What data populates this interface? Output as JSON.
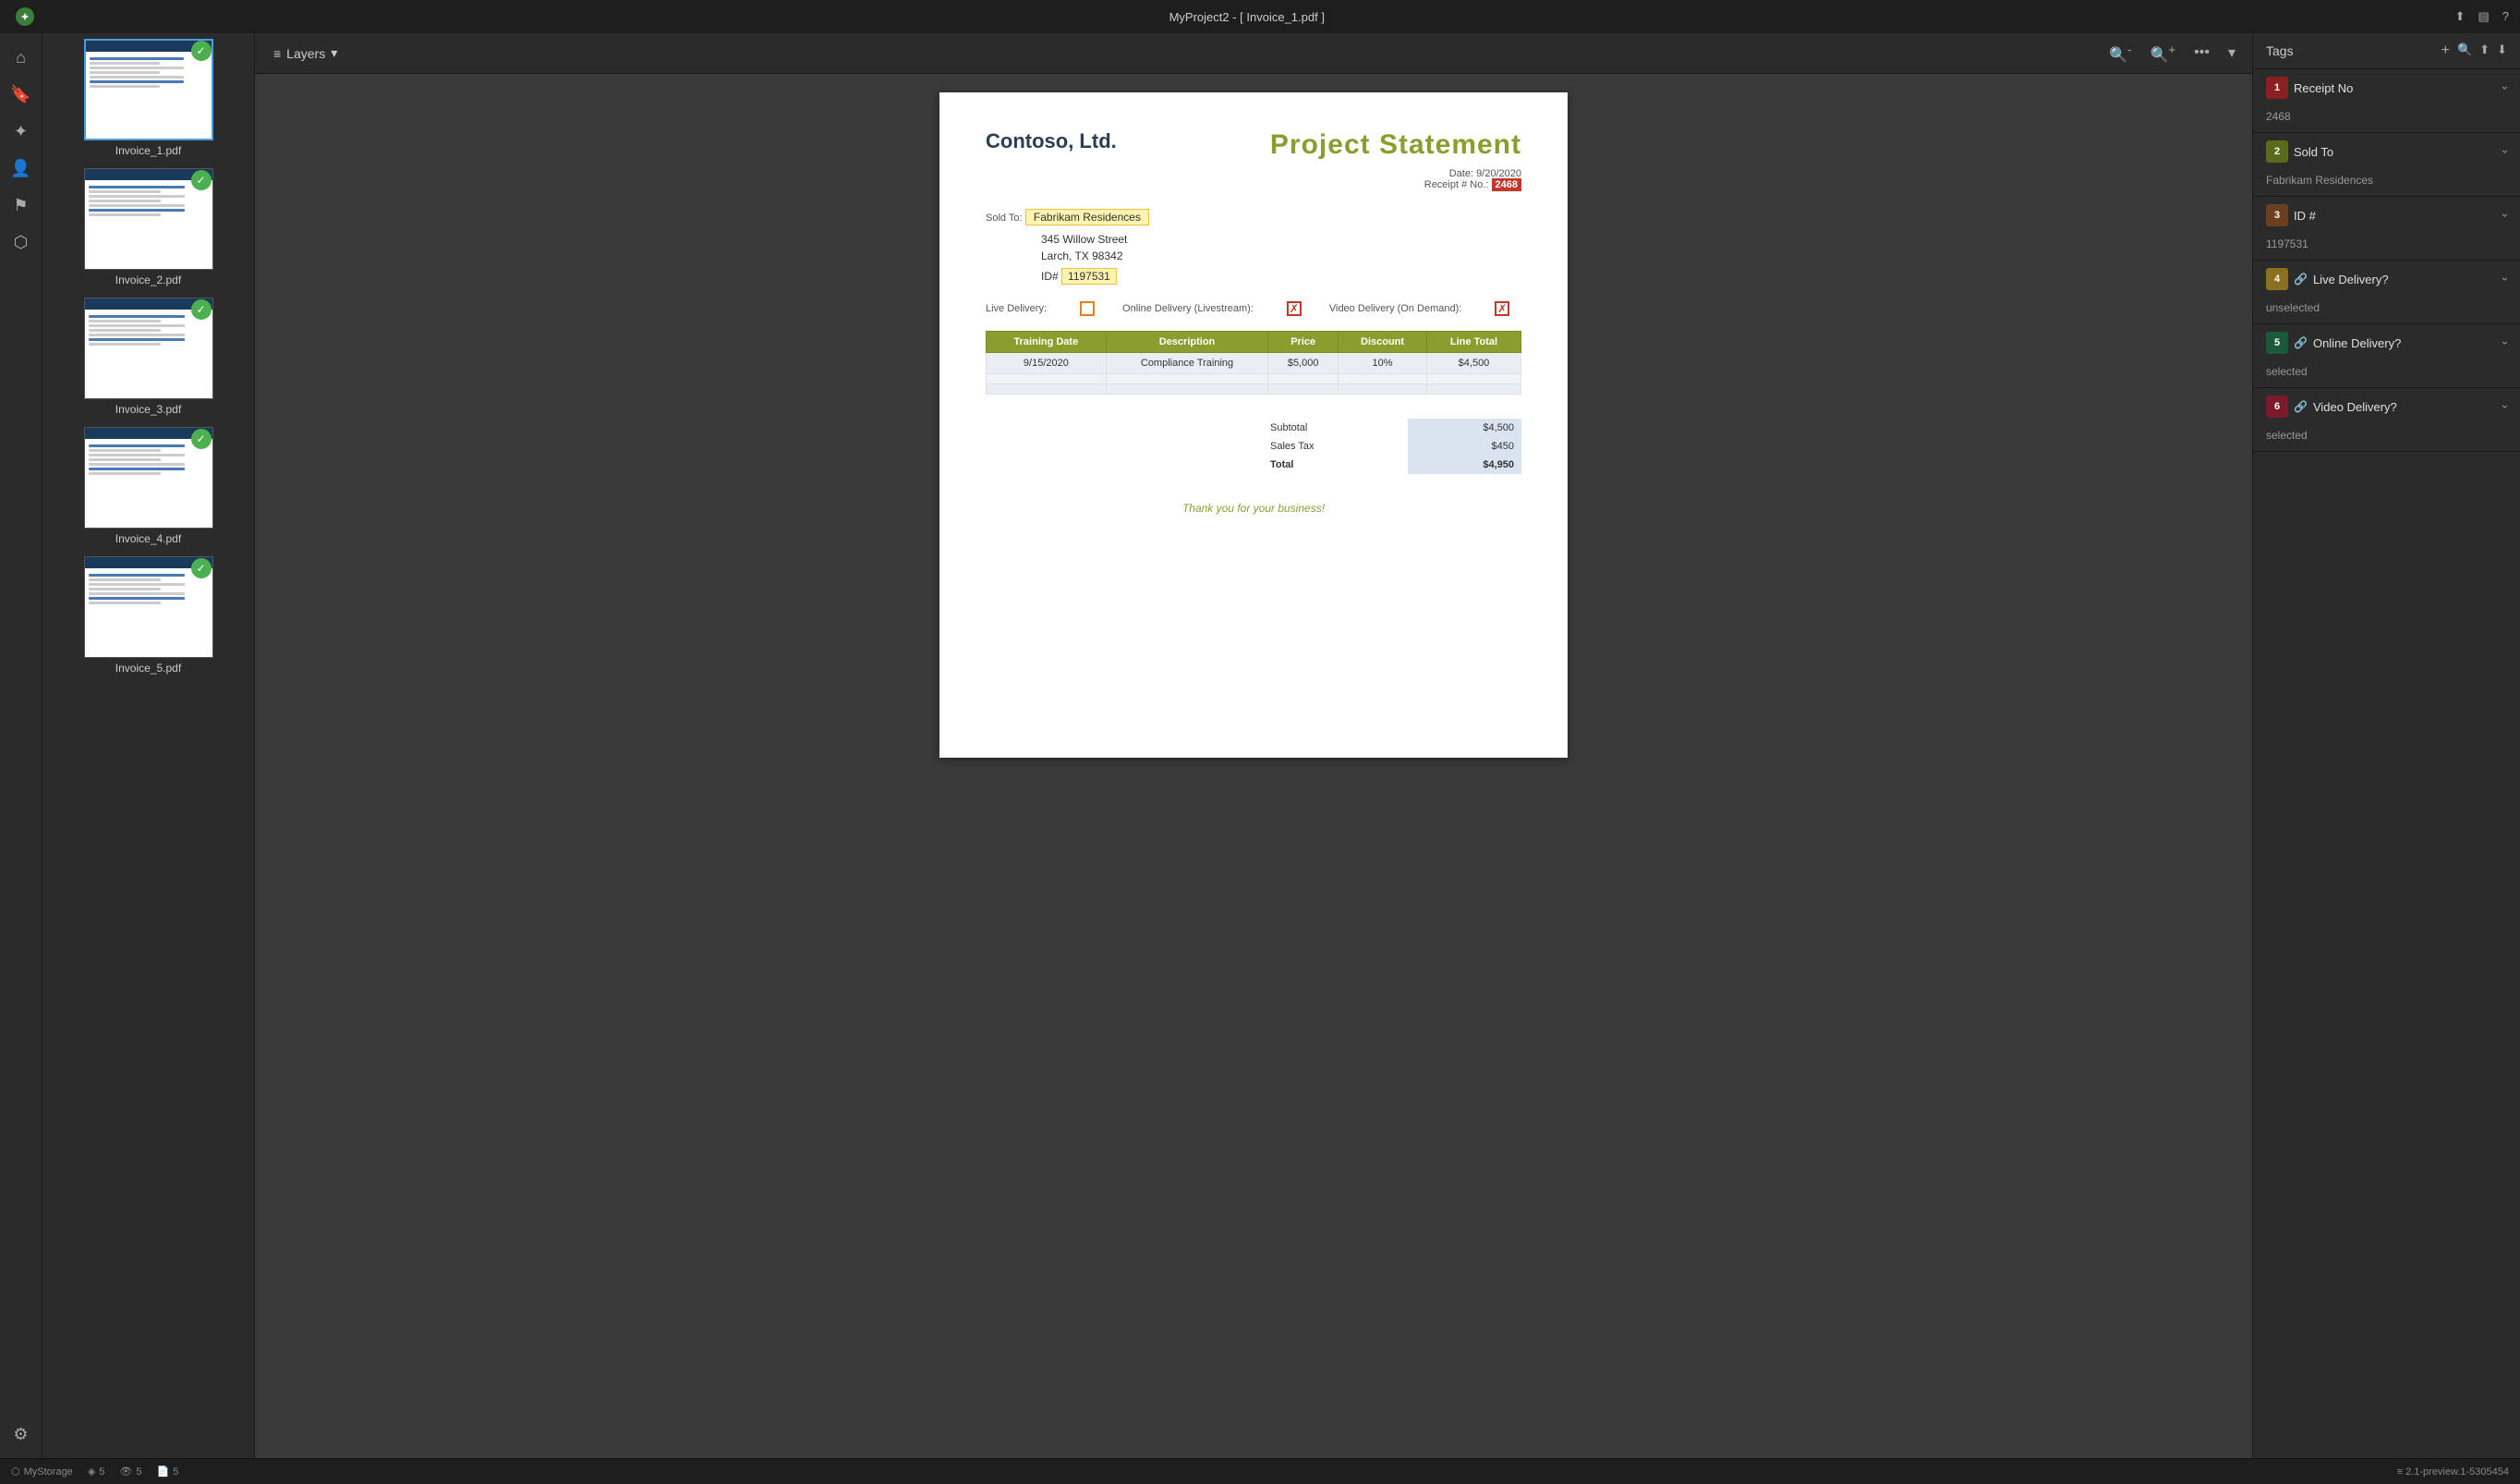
{
  "titlebar": {
    "title": "MyProject2 - [ Invoice_1.pdf ]",
    "icons": [
      "share",
      "panels",
      "help"
    ]
  },
  "toolbar": {
    "layers_label": "Layers",
    "zoom_out": "zoom-out",
    "zoom_in": "zoom-in",
    "more": "...",
    "chevron": "▾"
  },
  "files": [
    {
      "name": "Invoice_1.pdf",
      "active": true,
      "checked": true
    },
    {
      "name": "Invoice_2.pdf",
      "active": false,
      "checked": true
    },
    {
      "name": "Invoice_3.pdf",
      "active": false,
      "checked": true
    },
    {
      "name": "Invoice_4.pdf",
      "active": false,
      "checked": true
    },
    {
      "name": "Invoice_5.pdf",
      "active": false,
      "checked": true
    }
  ],
  "invoice": {
    "company": "Contoso, Ltd.",
    "title": "Project Statement",
    "date_label": "Date:",
    "date_value": "9/20/2020",
    "receipt_label": "Receipt # No.:",
    "receipt_value": "2468",
    "sold_to_label": "Sold To:",
    "sold_to_value": "Fabrikam Residences",
    "address_line1": "345 Willow Street",
    "address_line2": "Larch, TX  98342",
    "id_label": "ID#",
    "id_value": "1197531",
    "delivery": {
      "live_label": "Live Delivery:",
      "live_checked": false,
      "online_label": "Online Delivery (Livestream):",
      "online_checked": true,
      "video_label": "Video Delivery (On Demand):",
      "video_checked": true
    },
    "table": {
      "headers": [
        "Training Date",
        "Description",
        "Price",
        "Discount",
        "Line Total"
      ],
      "rows": [
        [
          "9/15/2020",
          "Compliance Training",
          "$5,000",
          "10%",
          "$4,500"
        ],
        [
          "",
          "",
          "",
          "",
          ""
        ],
        [
          "",
          "",
          "",
          "",
          ""
        ]
      ]
    },
    "totals": {
      "subtotal_label": "Subtotal",
      "subtotal_value": "$4,500",
      "tax_label": "Sales Tax",
      "tax_value": "$450",
      "total_label": "Total",
      "total_value": "$4,950"
    },
    "thank_you": "Thank you for your business!"
  },
  "tags": {
    "title": "Tags",
    "add_icon": "+",
    "search_icon": "🔍",
    "items": [
      {
        "id": 1,
        "label": "Receipt No",
        "value": "2468",
        "badge_color": "badge-red",
        "has_link": false,
        "expanded": true
      },
      {
        "id": 2,
        "label": "Sold To",
        "value": "Fabrikam Residences",
        "badge_color": "badge-olive",
        "has_link": false,
        "expanded": true
      },
      {
        "id": 3,
        "label": "ID #",
        "value": "1197531",
        "badge_color": "badge-brown",
        "has_link": false,
        "expanded": true
      },
      {
        "id": 4,
        "label": "Live Delivery?",
        "value": "unselected",
        "badge_color": "badge-goldenrod",
        "has_link": true,
        "expanded": true
      },
      {
        "id": 5,
        "label": "Online Delivery?",
        "value": "selected",
        "badge_color": "badge-darkgreen",
        "has_link": true,
        "expanded": true
      },
      {
        "id": 6,
        "label": "Video Delivery?",
        "value": "selected",
        "badge_color": "badge-darkred2",
        "has_link": true,
        "expanded": true
      }
    ]
  },
  "statusbar": {
    "storage_label": "MyStorage",
    "layers_count": "5",
    "views_count": "5",
    "files_count": "5",
    "version": "2.1-preview.1-5305454"
  }
}
